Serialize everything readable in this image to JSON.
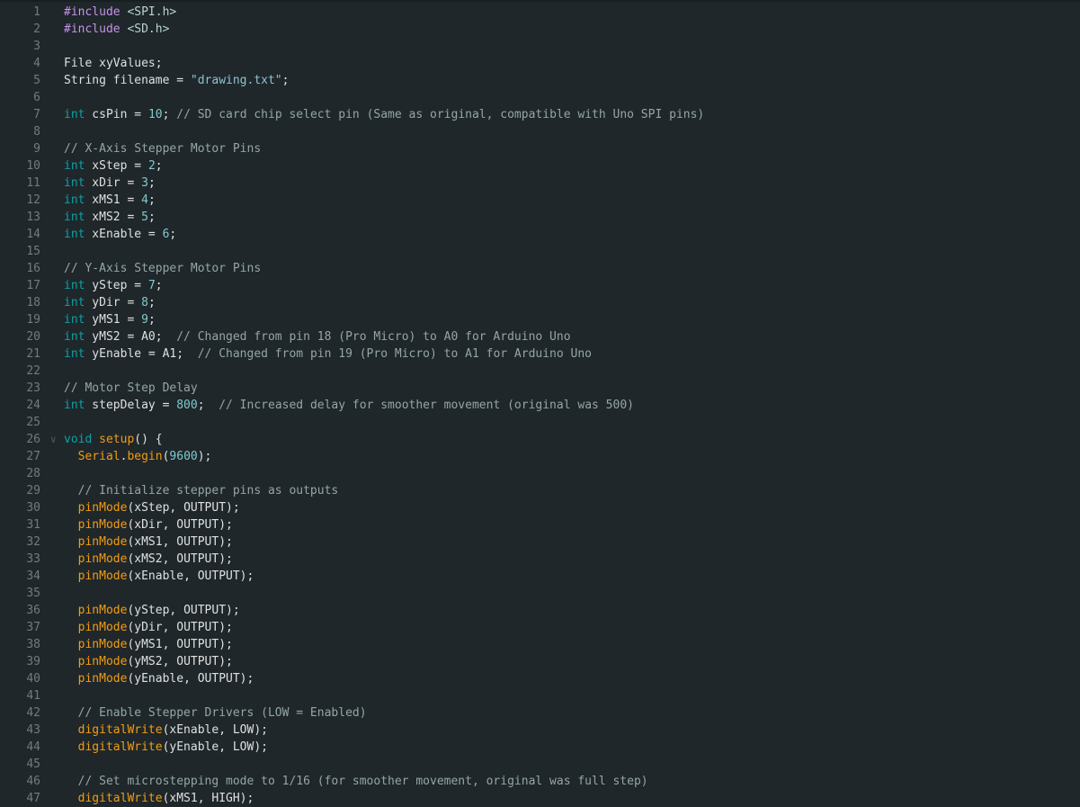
{
  "editor": {
    "language": "Arduino C++",
    "lines": [
      [
        {
          "t": "pre",
          "v": "#include "
        },
        {
          "t": "inc",
          "v": "<SPI.h>"
        }
      ],
      [
        {
          "t": "pre",
          "v": "#include "
        },
        {
          "t": "inc",
          "v": "<SD.h>"
        }
      ],
      [],
      [
        {
          "t": "id",
          "v": "File xyValues;"
        }
      ],
      [
        {
          "t": "id",
          "v": "String filename = "
        },
        {
          "t": "str",
          "v": "\"drawing.txt\""
        },
        {
          "t": "id",
          "v": ";"
        }
      ],
      [],
      [
        {
          "t": "kw",
          "v": "int"
        },
        {
          "t": "id",
          "v": " csPin = "
        },
        {
          "t": "num",
          "v": "10"
        },
        {
          "t": "id",
          "v": "; "
        },
        {
          "t": "cm",
          "v": "// SD card chip select pin (Same as original, compatible with Uno SPI pins)"
        }
      ],
      [],
      [
        {
          "t": "cm",
          "v": "// X-Axis Stepper Motor Pins"
        }
      ],
      [
        {
          "t": "kw",
          "v": "int"
        },
        {
          "t": "id",
          "v": " xStep = "
        },
        {
          "t": "num",
          "v": "2"
        },
        {
          "t": "id",
          "v": ";"
        }
      ],
      [
        {
          "t": "kw",
          "v": "int"
        },
        {
          "t": "id",
          "v": " xDir = "
        },
        {
          "t": "num",
          "v": "3"
        },
        {
          "t": "id",
          "v": ";"
        }
      ],
      [
        {
          "t": "kw",
          "v": "int"
        },
        {
          "t": "id",
          "v": " xMS1 = "
        },
        {
          "t": "num",
          "v": "4"
        },
        {
          "t": "id",
          "v": ";"
        }
      ],
      [
        {
          "t": "kw",
          "v": "int"
        },
        {
          "t": "id",
          "v": " xMS2 = "
        },
        {
          "t": "num",
          "v": "5"
        },
        {
          "t": "id",
          "v": ";"
        }
      ],
      [
        {
          "t": "kw",
          "v": "int"
        },
        {
          "t": "id",
          "v": " xEnable = "
        },
        {
          "t": "num",
          "v": "6"
        },
        {
          "t": "id",
          "v": ";"
        }
      ],
      [],
      [
        {
          "t": "cm",
          "v": "// Y-Axis Stepper Motor Pins"
        }
      ],
      [
        {
          "t": "kw",
          "v": "int"
        },
        {
          "t": "id",
          "v": " yStep = "
        },
        {
          "t": "num",
          "v": "7"
        },
        {
          "t": "id",
          "v": ";"
        }
      ],
      [
        {
          "t": "kw",
          "v": "int"
        },
        {
          "t": "id",
          "v": " yDir = "
        },
        {
          "t": "num",
          "v": "8"
        },
        {
          "t": "id",
          "v": ";"
        }
      ],
      [
        {
          "t": "kw",
          "v": "int"
        },
        {
          "t": "id",
          "v": " yMS1 = "
        },
        {
          "t": "num",
          "v": "9"
        },
        {
          "t": "id",
          "v": ";"
        }
      ],
      [
        {
          "t": "kw",
          "v": "int"
        },
        {
          "t": "id",
          "v": " yMS2 = A0;  "
        },
        {
          "t": "cm",
          "v": "// Changed from pin 18 (Pro Micro) to A0 for Arduino Uno"
        }
      ],
      [
        {
          "t": "kw",
          "v": "int"
        },
        {
          "t": "id",
          "v": " yEnable = A1;  "
        },
        {
          "t": "cm",
          "v": "// Changed from pin 19 (Pro Micro) to A1 for Arduino Uno"
        }
      ],
      [],
      [
        {
          "t": "cm",
          "v": "// Motor Step Delay"
        }
      ],
      [
        {
          "t": "kw",
          "v": "int"
        },
        {
          "t": "id",
          "v": " stepDelay = "
        },
        {
          "t": "num",
          "v": "800"
        },
        {
          "t": "id",
          "v": ";  "
        },
        {
          "t": "cm",
          "v": "// Increased delay for smoother movement (original was 500)"
        }
      ],
      [],
      [
        {
          "t": "kw",
          "v": "void"
        },
        {
          "t": "id",
          "v": " "
        },
        {
          "t": "fn",
          "v": "setup"
        },
        {
          "t": "id",
          "v": "() {"
        }
      ],
      [
        {
          "t": "id",
          "v": "  "
        },
        {
          "t": "fn",
          "v": "Serial"
        },
        {
          "t": "id",
          "v": "."
        },
        {
          "t": "fn",
          "v": "begin"
        },
        {
          "t": "id",
          "v": "("
        },
        {
          "t": "num",
          "v": "9600"
        },
        {
          "t": "id",
          "v": ");"
        }
      ],
      [],
      [
        {
          "t": "id",
          "v": "  "
        },
        {
          "t": "cm",
          "v": "// Initialize stepper pins as outputs"
        }
      ],
      [
        {
          "t": "id",
          "v": "  "
        },
        {
          "t": "fn",
          "v": "pinMode"
        },
        {
          "t": "id",
          "v": "(xStep, OUTPUT);"
        }
      ],
      [
        {
          "t": "id",
          "v": "  "
        },
        {
          "t": "fn",
          "v": "pinMode"
        },
        {
          "t": "id",
          "v": "(xDir, OUTPUT);"
        }
      ],
      [
        {
          "t": "id",
          "v": "  "
        },
        {
          "t": "fn",
          "v": "pinMode"
        },
        {
          "t": "id",
          "v": "(xMS1, OUTPUT);"
        }
      ],
      [
        {
          "t": "id",
          "v": "  "
        },
        {
          "t": "fn",
          "v": "pinMode"
        },
        {
          "t": "id",
          "v": "(xMS2, OUTPUT);"
        }
      ],
      [
        {
          "t": "id",
          "v": "  "
        },
        {
          "t": "fn",
          "v": "pinMode"
        },
        {
          "t": "id",
          "v": "(xEnable, OUTPUT);"
        }
      ],
      [],
      [
        {
          "t": "id",
          "v": "  "
        },
        {
          "t": "fn",
          "v": "pinMode"
        },
        {
          "t": "id",
          "v": "(yStep, OUTPUT);"
        }
      ],
      [
        {
          "t": "id",
          "v": "  "
        },
        {
          "t": "fn",
          "v": "pinMode"
        },
        {
          "t": "id",
          "v": "(yDir, OUTPUT);"
        }
      ],
      [
        {
          "t": "id",
          "v": "  "
        },
        {
          "t": "fn",
          "v": "pinMode"
        },
        {
          "t": "id",
          "v": "(yMS1, OUTPUT);"
        }
      ],
      [
        {
          "t": "id",
          "v": "  "
        },
        {
          "t": "fn",
          "v": "pinMode"
        },
        {
          "t": "id",
          "v": "(yMS2, OUTPUT);"
        }
      ],
      [
        {
          "t": "id",
          "v": "  "
        },
        {
          "t": "fn",
          "v": "pinMode"
        },
        {
          "t": "id",
          "v": "(yEnable, OUTPUT);"
        }
      ],
      [],
      [
        {
          "t": "id",
          "v": "  "
        },
        {
          "t": "cm",
          "v": "// Enable Stepper Drivers (LOW = Enabled)"
        }
      ],
      [
        {
          "t": "id",
          "v": "  "
        },
        {
          "t": "fn",
          "v": "digitalWrite"
        },
        {
          "t": "id",
          "v": "(xEnable, LOW);"
        }
      ],
      [
        {
          "t": "id",
          "v": "  "
        },
        {
          "t": "fn",
          "v": "digitalWrite"
        },
        {
          "t": "id",
          "v": "(yEnable, LOW);"
        }
      ],
      [],
      [
        {
          "t": "id",
          "v": "  "
        },
        {
          "t": "cm",
          "v": "// Set microstepping mode to 1/16 (for smoother movement, original was full step)"
        }
      ],
      [
        {
          "t": "id",
          "v": "  "
        },
        {
          "t": "fn",
          "v": "digitalWrite"
        },
        {
          "t": "id",
          "v": "(xMS1, HIGH);"
        }
      ]
    ],
    "fold_lines": [
      26
    ],
    "colors": {
      "background": "#1f272a",
      "gutter_text": "#6f7c82",
      "preprocessor": "#c792ea",
      "keyword": "#0ca1a6",
      "number": "#7fcbcd",
      "string": "#8ec3d1",
      "comment": "#95a5a6",
      "function": "#f39c12",
      "identifier": "#e0e0e0"
    }
  }
}
